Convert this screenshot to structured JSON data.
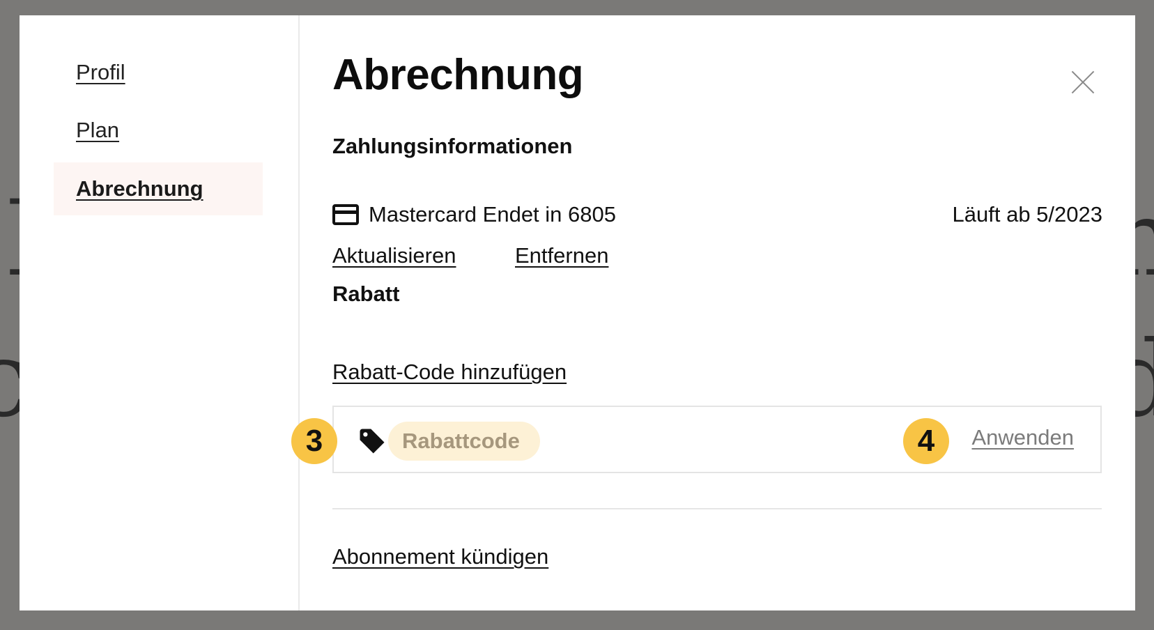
{
  "sidebar": {
    "items": [
      {
        "label": "Profil",
        "active": false
      },
      {
        "label": "Plan",
        "active": false
      },
      {
        "label": "Abrechnung",
        "active": true
      }
    ]
  },
  "main": {
    "title": "Abrechnung",
    "close_icon": "close-icon",
    "payment": {
      "heading": "Zahlungsinformationen",
      "card_icon": "credit-card-icon",
      "card_text": "Mastercard Endet in 6805",
      "expiry": "Läuft ab 5/2023",
      "update_label": "Aktualisieren",
      "remove_label": "Entfernen"
    },
    "discount": {
      "heading": "Rabatt",
      "add_code_label": "Rabatt-Code hinzufügen",
      "tag_icon": "tag-icon",
      "code_input_value": "",
      "code_input_placeholder": "Rabattcode",
      "apply_label": "Anwenden"
    },
    "cancel_label": "Abonnement kündigen"
  },
  "annotations": {
    "badge_3": "3",
    "badge_4": "4",
    "badge_color": "#f8c445"
  },
  "colors": {
    "overlay": "#7a7977",
    "active_item_bg": "#fdf5f3",
    "input_highlight": "#fdf1d6"
  }
}
